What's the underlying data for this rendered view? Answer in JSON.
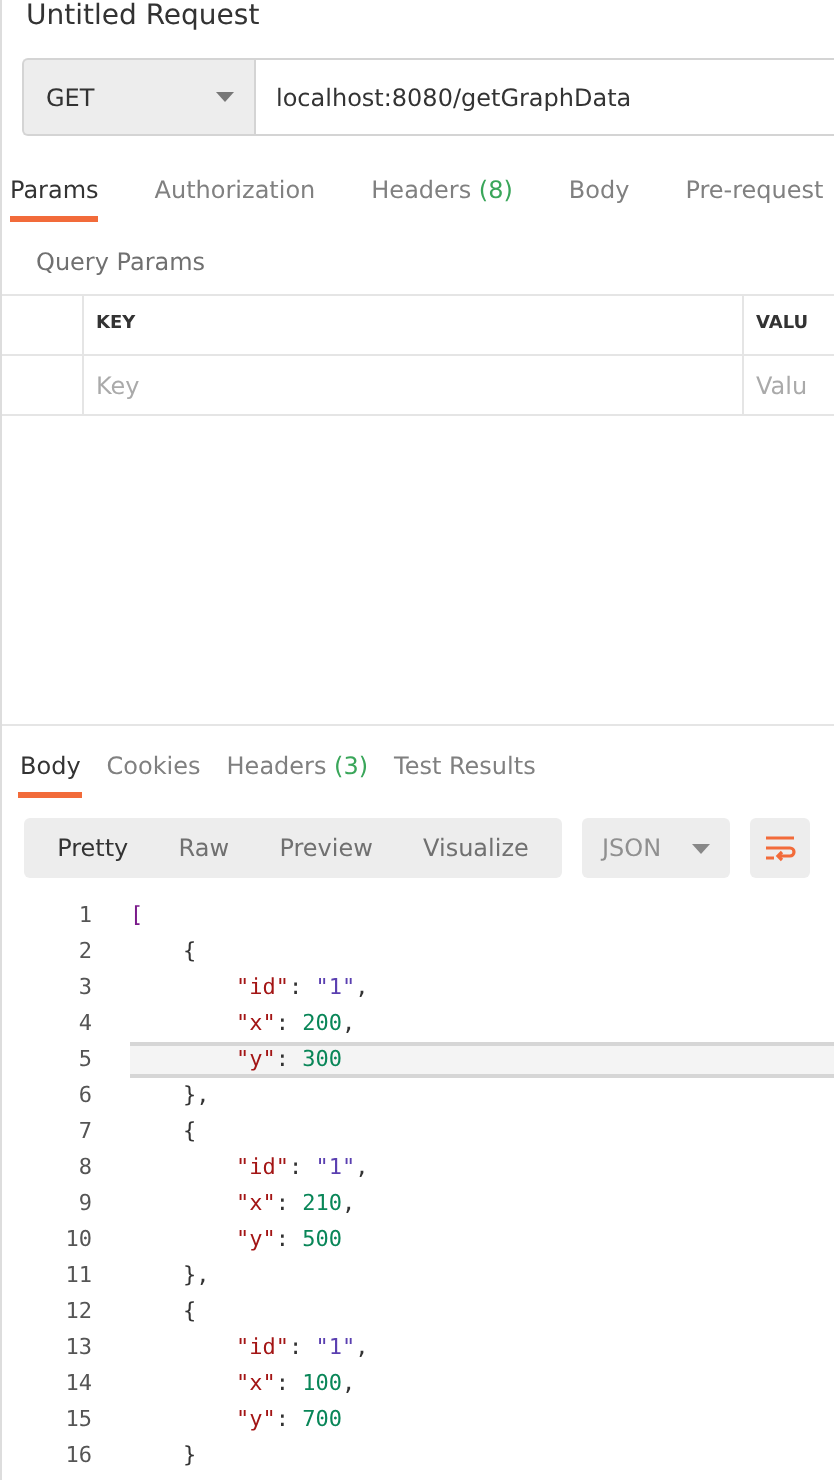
{
  "title": "Untitled Request",
  "request": {
    "method": "GET",
    "url": "localhost:8080/getGraphData"
  },
  "request_tabs": [
    {
      "label": "Params",
      "selected": true
    },
    {
      "label": "Authorization",
      "selected": false
    },
    {
      "label": "Headers",
      "count": "(8)",
      "selected": false
    },
    {
      "label": "Body",
      "selected": false
    },
    {
      "label": "Pre-request",
      "selected": false
    }
  ],
  "section_title": "Query Params",
  "params_table": {
    "columns": [
      "KEY",
      "VALU"
    ],
    "placeholders": [
      "Key",
      "Valu"
    ]
  },
  "response_tabs": [
    {
      "label": "Body",
      "selected": true
    },
    {
      "label": "Cookies",
      "selected": false
    },
    {
      "label": "Headers",
      "count": "(3)",
      "selected": false
    },
    {
      "label": "Test Results",
      "selected": false
    }
  ],
  "view_modes": [
    {
      "label": "Pretty",
      "selected": true
    },
    {
      "label": "Raw",
      "selected": false
    },
    {
      "label": "Preview",
      "selected": false
    },
    {
      "label": "Visualize",
      "selected": false
    }
  ],
  "format": "JSON",
  "code_lines": [
    {
      "number": "1",
      "selected": false,
      "tokens": [
        {
          "kind": "bracket",
          "text": "["
        }
      ]
    },
    {
      "number": "2",
      "selected": false,
      "tokens": [
        {
          "kind": "punct",
          "text": "    {"
        }
      ]
    },
    {
      "number": "3",
      "selected": false,
      "tokens": [
        {
          "kind": "key",
          "text": "        \"id\""
        },
        {
          "kind": "punct",
          "text": ": "
        },
        {
          "kind": "string",
          "text": "\"1\""
        },
        {
          "kind": "punct",
          "text": ","
        }
      ]
    },
    {
      "number": "4",
      "selected": false,
      "tokens": [
        {
          "kind": "key",
          "text": "        \"x\""
        },
        {
          "kind": "punct",
          "text": ": "
        },
        {
          "kind": "number",
          "text": "200"
        },
        {
          "kind": "punct",
          "text": ","
        }
      ]
    },
    {
      "number": "5",
      "selected": true,
      "tokens": [
        {
          "kind": "key",
          "text": "        \"y\""
        },
        {
          "kind": "punct",
          "text": ": "
        },
        {
          "kind": "number",
          "text": "300"
        }
      ]
    },
    {
      "number": "6",
      "selected": false,
      "tokens": [
        {
          "kind": "punct",
          "text": "    },"
        }
      ]
    },
    {
      "number": "7",
      "selected": false,
      "tokens": [
        {
          "kind": "punct",
          "text": "    {"
        }
      ]
    },
    {
      "number": "8",
      "selected": false,
      "tokens": [
        {
          "kind": "key",
          "text": "        \"id\""
        },
        {
          "kind": "punct",
          "text": ": "
        },
        {
          "kind": "string",
          "text": "\"1\""
        },
        {
          "kind": "punct",
          "text": ","
        }
      ]
    },
    {
      "number": "9",
      "selected": false,
      "tokens": [
        {
          "kind": "key",
          "text": "        \"x\""
        },
        {
          "kind": "punct",
          "text": ": "
        },
        {
          "kind": "number",
          "text": "210"
        },
        {
          "kind": "punct",
          "text": ","
        }
      ]
    },
    {
      "number": "10",
      "selected": false,
      "tokens": [
        {
          "kind": "key",
          "text": "        \"y\""
        },
        {
          "kind": "punct",
          "text": ": "
        },
        {
          "kind": "number",
          "text": "500"
        }
      ]
    },
    {
      "number": "11",
      "selected": false,
      "tokens": [
        {
          "kind": "punct",
          "text": "    },"
        }
      ]
    },
    {
      "number": "12",
      "selected": false,
      "tokens": [
        {
          "kind": "punct",
          "text": "    {"
        }
      ]
    },
    {
      "number": "13",
      "selected": false,
      "tokens": [
        {
          "kind": "key",
          "text": "        \"id\""
        },
        {
          "kind": "punct",
          "text": ": "
        },
        {
          "kind": "string",
          "text": "\"1\""
        },
        {
          "kind": "punct",
          "text": ","
        }
      ]
    },
    {
      "number": "14",
      "selected": false,
      "tokens": [
        {
          "kind": "key",
          "text": "        \"x\""
        },
        {
          "kind": "punct",
          "text": ": "
        },
        {
          "kind": "number",
          "text": "100"
        },
        {
          "kind": "punct",
          "text": ","
        }
      ]
    },
    {
      "number": "15",
      "selected": false,
      "tokens": [
        {
          "kind": "key",
          "text": "        \"y\""
        },
        {
          "kind": "punct",
          "text": ": "
        },
        {
          "kind": "number",
          "text": "700"
        }
      ]
    },
    {
      "number": "16",
      "selected": false,
      "tokens": [
        {
          "kind": "punct",
          "text": "    }"
        }
      ]
    }
  ]
}
